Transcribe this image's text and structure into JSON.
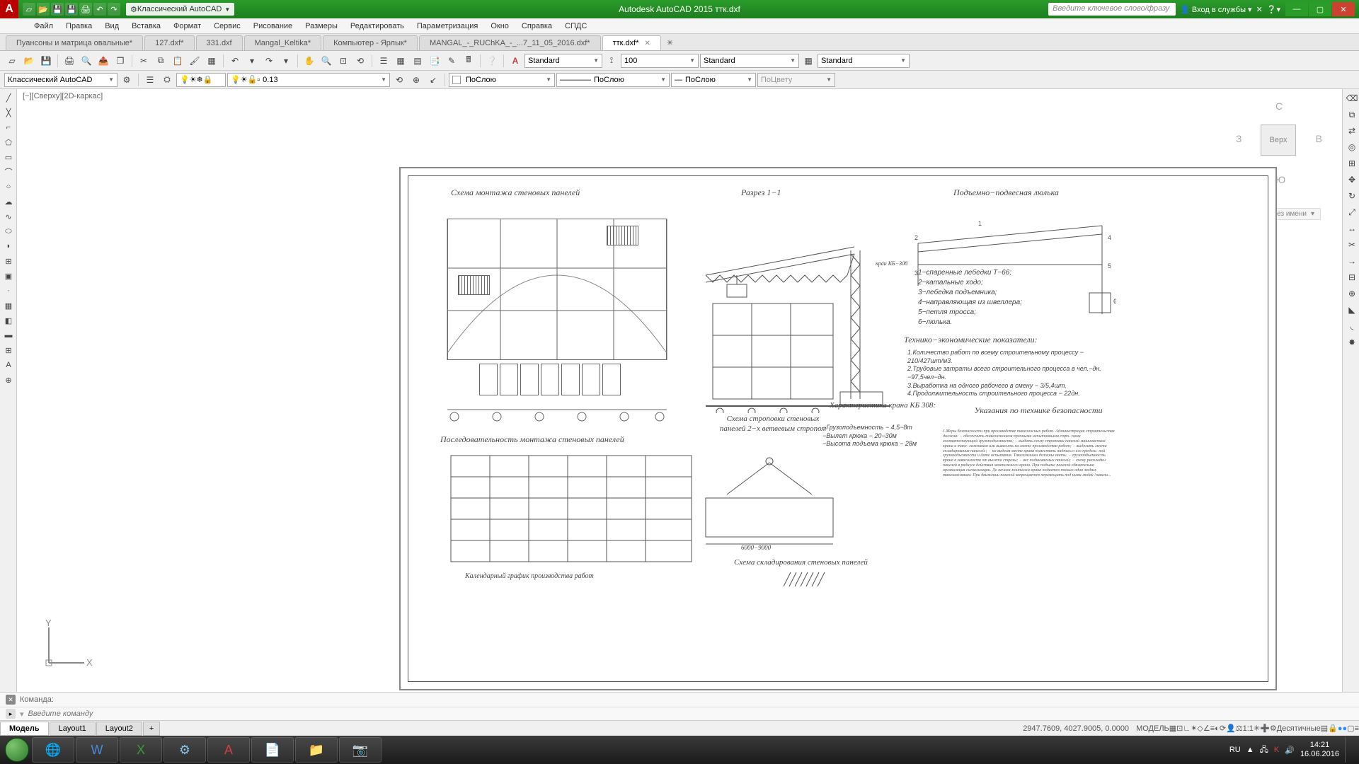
{
  "titlebar": {
    "workspace": "Классический AutoCAD",
    "app_title": "Autodesk AutoCAD 2015   ттк.dxf",
    "search_placeholder": "Введите ключевое слово/фразу",
    "signin": "Вход в службы"
  },
  "menu": [
    "Файл",
    "Правка",
    "Вид",
    "Вставка",
    "Формат",
    "Сервис",
    "Рисование",
    "Размеры",
    "Редактировать",
    "Параметризация",
    "Окно",
    "Справка",
    "СПДС"
  ],
  "doc_tabs": [
    {
      "label": "Пуансоны и матрица овальные*",
      "active": false
    },
    {
      "label": "127.dxf*",
      "active": false
    },
    {
      "label": "331.dxf",
      "active": false
    },
    {
      "label": "Mangal_Keltika*",
      "active": false
    },
    {
      "label": "Компьютер - Ярлык*",
      "active": false
    },
    {
      "label": "MANGAL_-_RUChKA_-_...7_11_05_2016.dxf*",
      "active": false
    },
    {
      "label": "ттк.dxf*",
      "active": true
    }
  ],
  "tb1": {
    "style1": "Standard",
    "annoscale": "100",
    "style2": "Standard",
    "style3": "Standard"
  },
  "tb2": {
    "workspace": "Классический AutoCAD",
    "lnval": "0.13",
    "layer": "ПоСлою",
    "ltype": "ПоСлою",
    "lweight": "ПоСлою",
    "plotstyle": "ПоЦвету"
  },
  "viewport_label": "[−][Сверху][2D-каркас]",
  "viewcube": {
    "top": "Верх",
    "n": "С",
    "s": "Ю",
    "e": "В",
    "w": "З",
    "vs": "Без имени"
  },
  "drawing": {
    "t1": "Схема монтажа стеновых панелей",
    "t2": "Разрез 1−1",
    "t3": "Подъемно−подвесная люлька",
    "t4": "Последовательность монтажа стеновых панелей",
    "t5": "Схема строповки стеновых панелей 2−х ветвевым стропом",
    "t6": "Характеристика крана КБ 308:",
    "t7": "Технико−экономические показатели:",
    "t8": "Указания по технике безопасности",
    "t9": "Схема складирования стеновых панелей",
    "t10": "Календарный график производства работ",
    "legend": [
      "1−спаренные лебедки Т−66;",
      "2−катальные ходо;",
      "3−лебедка подъемника;",
      "4−направляющая из швеллера;",
      "5−петля тросса;",
      "6−люлька."
    ],
    "crane": [
      "−Грузоподъемность − 4,5−8т",
      "−Вылет крюка − 20−30м",
      "−Высота подъема крюка − 28м"
    ],
    "tech": [
      "1.Количество работ по всему строительному процессу − 210/427шт/м3.",
      "2.Трудовые затраты всего строительного процесса в чел.−дн. −97,5чел−дн.",
      "3.Выработка на одного рабочего в смену − 3/5,4шт.",
      "4.Продолжительность строительного процесса − 22дн."
    ],
    "dim_label": "6000−9000",
    "crane_label": "кран КБ−308"
  },
  "cmd": {
    "history": "Команда:",
    "placeholder": "Введите команду"
  },
  "model_tabs": [
    "Модель",
    "Layout1",
    "Layout2"
  ],
  "status": {
    "coords": "2947.7609, 4027.9005, 0.0000",
    "space": "МОДЕЛЬ",
    "scale": "1:1",
    "units": "Десятичные"
  },
  "tray": {
    "lang": "RU",
    "time": "14:21",
    "date": "16.06.2016"
  }
}
